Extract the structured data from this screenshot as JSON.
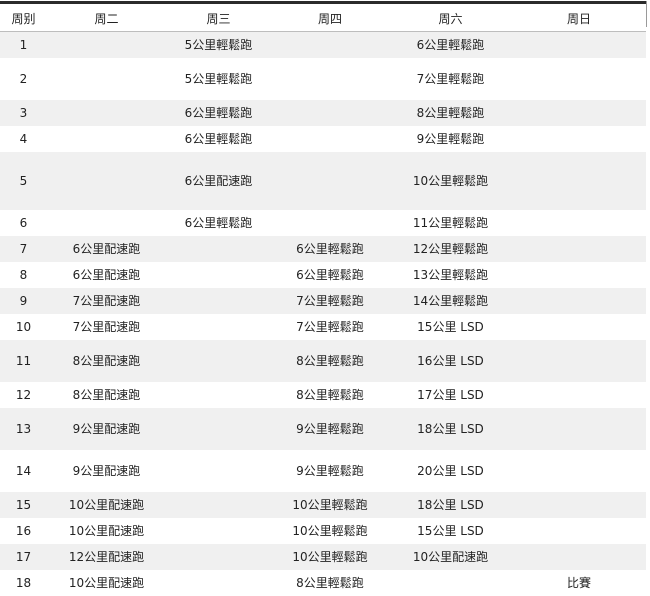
{
  "table": {
    "headers": [
      "周别",
      "周二",
      "周三",
      "周四",
      "周六",
      "周日"
    ],
    "rows": [
      {
        "week": "1",
        "tue": "",
        "wed": "5公里輕鬆跑",
        "thu": "",
        "sat": "6公里輕鬆跑",
        "sun": ""
      },
      {
        "week": "2",
        "tue": "",
        "wed": "5公里輕鬆跑",
        "thu": "",
        "sat": "7公里輕鬆跑",
        "sun": ""
      },
      {
        "week": "3",
        "tue": "",
        "wed": "6公里輕鬆跑",
        "thu": "",
        "sat": "8公里輕鬆跑",
        "sun": ""
      },
      {
        "week": "4",
        "tue": "",
        "wed": "6公里輕鬆跑",
        "thu": "",
        "sat": "9公里輕鬆跑",
        "sun": ""
      },
      {
        "week": "5",
        "tue": "",
        "wed": "6公里配速跑",
        "thu": "",
        "sat": "10公里輕鬆跑",
        "sun": ""
      },
      {
        "week": "6",
        "tue": "",
        "wed": "6公里輕鬆跑",
        "thu": "",
        "sat": "11公里輕鬆跑",
        "sun": ""
      },
      {
        "week": "7",
        "tue": "6公里配速跑",
        "wed": "",
        "thu": "6公里輕鬆跑",
        "sat": "12公里輕鬆跑",
        "sun": ""
      },
      {
        "week": "8",
        "tue": "6公里配速跑",
        "wed": "",
        "thu": "6公里輕鬆跑",
        "sat": "13公里輕鬆跑",
        "sun": ""
      },
      {
        "week": "9",
        "tue": "7公里配速跑",
        "wed": "",
        "thu": "7公里輕鬆跑",
        "sat": "14公里輕鬆跑",
        "sun": ""
      },
      {
        "week": "10",
        "tue": "7公里配速跑",
        "wed": "",
        "thu": "7公里輕鬆跑",
        "sat": "15公里 LSD",
        "sun": ""
      },
      {
        "week": "11",
        "tue": "8公里配速跑",
        "wed": "",
        "thu": "8公里輕鬆跑",
        "sat": "16公里 LSD",
        "sun": ""
      },
      {
        "week": "12",
        "tue": "8公里配速跑",
        "wed": "",
        "thu": "8公里輕鬆跑",
        "sat": "17公里 LSD",
        "sun": ""
      },
      {
        "week": "13",
        "tue": "9公里配速跑",
        "wed": "",
        "thu": "9公里輕鬆跑",
        "sat": "18公里 LSD",
        "sun": ""
      },
      {
        "week": "14",
        "tue": "9公里配速跑",
        "wed": "",
        "thu": "9公里輕鬆跑",
        "sat": "20公里 LSD",
        "sun": ""
      },
      {
        "week": "15",
        "tue": "10公里配速跑",
        "wed": "",
        "thu": "10公里輕鬆跑",
        "sat": "18公里 LSD",
        "sun": ""
      },
      {
        "week": "16",
        "tue": "10公里配速跑",
        "wed": "",
        "thu": "10公里輕鬆跑",
        "sat": "15公里 LSD",
        "sun": ""
      },
      {
        "week": "17",
        "tue": "12公里配速跑",
        "wed": "",
        "thu": "10公里輕鬆跑",
        "sat": "10公里配速跑",
        "sun": ""
      },
      {
        "week": "18",
        "tue": "10公里配速跑",
        "wed": "",
        "thu": "8公里輕鬆跑",
        "sat": "",
        "sun": "比賽"
      }
    ]
  },
  "colors": {
    "stripe": "#f0f0f0",
    "rule": "#2b2b2b",
    "text": "#222222"
  }
}
